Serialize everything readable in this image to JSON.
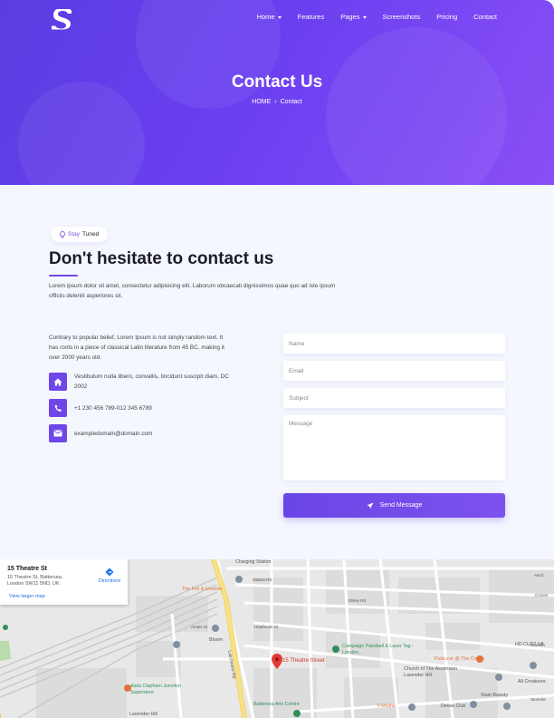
{
  "nav": {
    "items": [
      {
        "label": "Home",
        "dropdown": true
      },
      {
        "label": "Features",
        "dropdown": false
      },
      {
        "label": "Pages",
        "dropdown": true
      },
      {
        "label": "Screenshots",
        "dropdown": false
      },
      {
        "label": "Pricing",
        "dropdown": false
      },
      {
        "label": "Contact",
        "dropdown": false
      }
    ]
  },
  "hero": {
    "title": "Contact Us",
    "breadcrumb_home": "HOME",
    "breadcrumb_sep": "›",
    "breadcrumb_current": "Contact"
  },
  "section": {
    "badge_stay": "Stay",
    "badge_tuned": "Tuned",
    "heading": "Don't hesitate to contact us",
    "lead": "Lorem ipsum dolor sit amet, consectetur adipisicing elit. Laborum obcaecati dignissimos quae quo ad iste ipsum officiis deleniti asperiores sit."
  },
  "info": {
    "intro": "Contrary to popular belief, Lorem Ipsum is not simply random text. It has roots in a piece of classical Latin literature from 45 BC, making it over 2000 years old.",
    "address": "Vestibulum nulla libero, convallis, tincidunt suscipit diam, DC 2002",
    "phone": "+1 230 456 789-012 345 6789",
    "email": "exampledomain@domain.com"
  },
  "form": {
    "name_placeholder": "Name",
    "email_placeholder": "Email",
    "subject_placeholder": "Subject",
    "message_placeholder": "Message",
    "send_label": "Send Message"
  },
  "map": {
    "card_title": "15 Theatre St",
    "card_address": "15 Theatre St, Battersea, London SW11 5ND, UK",
    "directions": "Directions",
    "view_larger": "View larger map",
    "labels": {
      "charging": "Charging Station",
      "fox": "The Fox & Hounds",
      "sabine": "Sabine Rd",
      "elsley": "Elsley Rd",
      "heathcote": "Heathcote St",
      "amies": "Amies St",
      "bloom": "Bloom",
      "lavender": "Lavender Hill",
      "campaign": "Campaign Paintball & Laser Tag - London...",
      "theatre": "15 Theatre Street",
      "publove": "PubLove @ The Crown",
      "church": "Church of The Ascension Lavender Hill",
      "hdcutz": "HD CUTZ UK",
      "creatures": "All Creatures",
      "asda": "Asda Clapham Junction Superstore",
      "arts": "Battersea Arts Centre",
      "molino": "Il Molino",
      "devas": "Devas Club",
      "siam": "Siam Beauty",
      "latchmere": "Latchmere Rd",
      "drumsh": "Drumsh",
      "crosse": "Crosse",
      "asciz": "Asciz",
      "stonehe": "Stonehe"
    }
  },
  "colors": {
    "brand": "#6f47e9",
    "hero_start": "#5a3de0",
    "hero_end": "#8a4ff6"
  }
}
